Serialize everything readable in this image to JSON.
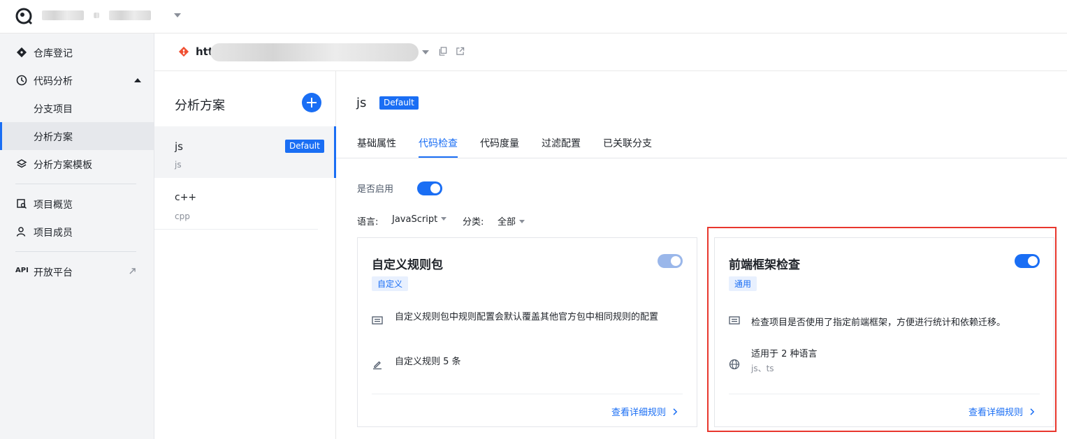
{
  "topbar": {
    "org_name": "",
    "project_name": ""
  },
  "sidebar": {
    "items": [
      {
        "label": "仓库登记",
        "icon": "git-diamond-icon"
      },
      {
        "label": "代码分析",
        "icon": "code-analysis-icon"
      },
      {
        "label": "分支项目"
      },
      {
        "label": "分析方案"
      },
      {
        "label": "分析方案模板",
        "icon": "layers-icon"
      },
      {
        "label": "项目概览",
        "icon": "overview-icon"
      },
      {
        "label": "项目成员",
        "icon": "user-icon"
      },
      {
        "label": "开放平台",
        "icon": "api-icon",
        "icon_text": "API"
      }
    ]
  },
  "repo": {
    "url_prefix": "htt"
  },
  "schemes": {
    "title": "分析方案",
    "items": [
      {
        "name": "js",
        "lang": "js",
        "badge": "Default"
      },
      {
        "name": "c++",
        "lang": "cpp"
      }
    ]
  },
  "main": {
    "title": "js",
    "badge": "Default",
    "tabs": [
      "基础属性",
      "代码检查",
      "代码度量",
      "过滤配置",
      "已关联分支"
    ],
    "active_tab": "代码检查",
    "enable_label": "是否启用",
    "enabled": true,
    "filters": {
      "language_label": "语言:",
      "language_value": "JavaScript",
      "category_label": "分类:",
      "category_value": "全部"
    }
  },
  "cards": [
    {
      "title": "自定义规则包",
      "tag": "自定义",
      "description": "自定义规则包中规则配置会默认覆盖其他官方包中相同规则的配置",
      "rules_text": "自定义规则 5 条",
      "link": "查看详细规则",
      "enabled": true,
      "toggle_disabled": true
    },
    {
      "title": "前端框架检查",
      "tag": "通用",
      "description": "检查项目是否使用了指定前端框架，方便进行统计和依赖迁移。",
      "languages_text": "适用于 2 种语言",
      "languages": "js、ts",
      "link": "查看详细规则",
      "enabled": true,
      "highlighted": true
    }
  ],
  "colors": {
    "accent": "#1a6ef4",
    "highlight": "#e8372d",
    "sidebar_bg": "#f3f4f6"
  }
}
